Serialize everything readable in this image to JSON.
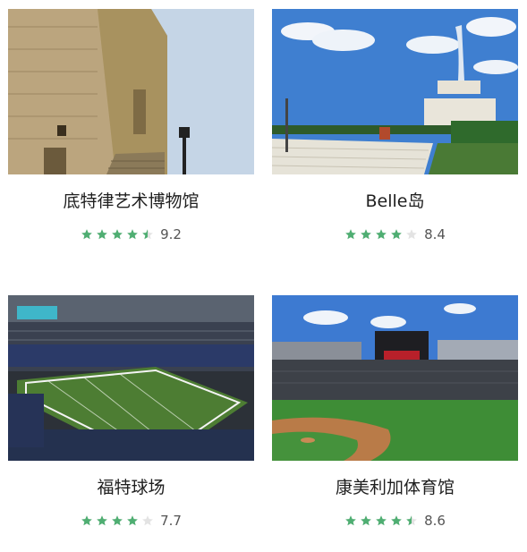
{
  "colors": {
    "star_filled": "#4fae72",
    "star_empty": "#e3e3e3"
  },
  "cards": [
    {
      "title": "底特律艺术博物馆",
      "rating": 9.2,
      "rating_text": "9.2",
      "stars": 4.5
    },
    {
      "title": "Belle岛",
      "rating": 8.4,
      "rating_text": "8.4",
      "stars": 4
    },
    {
      "title": "福特球场",
      "rating": 7.7,
      "rating_text": "7.7",
      "stars": 4
    },
    {
      "title": "康美利加体育馆",
      "rating": 8.6,
      "rating_text": "8.6",
      "stars": 4.5
    }
  ]
}
